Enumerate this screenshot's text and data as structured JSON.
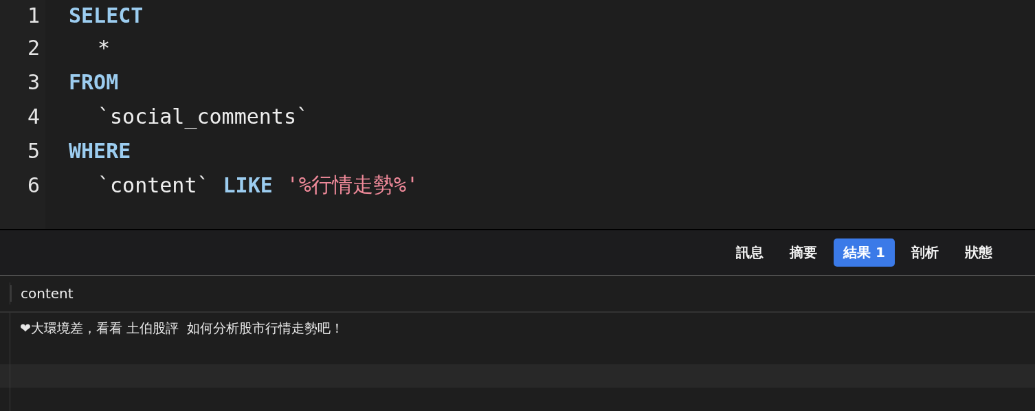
{
  "editor": {
    "lines": [
      {
        "number": "1",
        "indented": false,
        "tokens": [
          {
            "kind": "keyword",
            "text": "SELECT"
          }
        ]
      },
      {
        "number": "2",
        "indented": true,
        "tokens": [
          {
            "kind": "plain",
            "text": "*"
          }
        ]
      },
      {
        "number": "3",
        "indented": false,
        "tokens": [
          {
            "kind": "keyword",
            "text": "FROM"
          }
        ]
      },
      {
        "number": "4",
        "indented": true,
        "tokens": [
          {
            "kind": "plain",
            "text": "`social_comments`"
          }
        ]
      },
      {
        "number": "5",
        "indented": false,
        "tokens": [
          {
            "kind": "keyword",
            "text": "WHERE"
          }
        ]
      },
      {
        "number": "6",
        "indented": true,
        "tokens": [
          {
            "kind": "plain",
            "text": "`content`"
          },
          {
            "kind": "keyword",
            "text": "LIKE"
          },
          {
            "kind": "string",
            "text": "'%行情走勢%'"
          }
        ]
      }
    ]
  },
  "tabs": [
    {
      "label": "訊息",
      "selected": false
    },
    {
      "label": "摘要",
      "selected": false
    },
    {
      "label": "結果 1",
      "selected": true
    },
    {
      "label": "剖析",
      "selected": false
    },
    {
      "label": "狀態",
      "selected": false
    }
  ],
  "table": {
    "columns": [
      "content"
    ],
    "rows": [
      [
        "❤大環境差，看看 土伯股評  如何分析股市行情走勢吧！"
      ]
    ]
  }
}
